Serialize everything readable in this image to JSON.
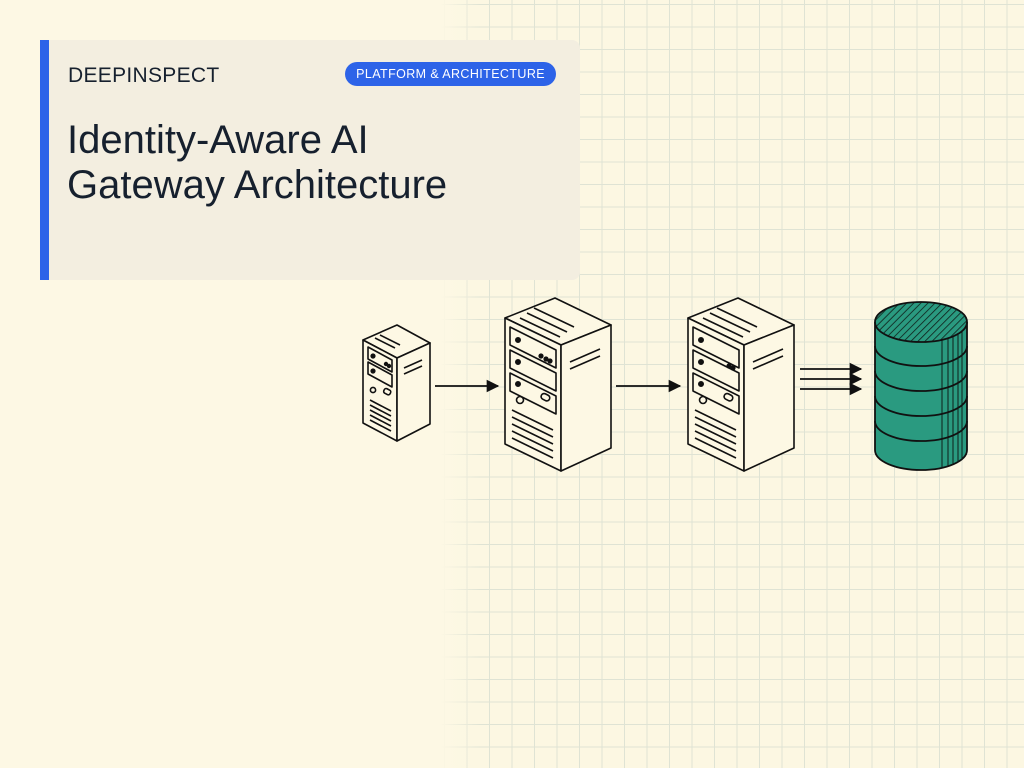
{
  "brand": {
    "name": "DEEPINSPECT"
  },
  "tag": {
    "label": "PLATFORM & ARCHITECTURE"
  },
  "title": {
    "line1": "Identity-Aware AI",
    "line2": "Gateway Architecture"
  },
  "colors": {
    "accent": "#2d63e8",
    "database": "#2a9a80",
    "background": "#fdf8e4",
    "card": "#f3eee0",
    "text": "#16202e"
  },
  "diagram": {
    "nodes": [
      {
        "icon": "server-tower-icon"
      },
      {
        "icon": "server-tower-icon"
      },
      {
        "icon": "server-tower-icon"
      },
      {
        "icon": "database-icon"
      }
    ],
    "edges": [
      {
        "from": 0,
        "to": 1,
        "type": "single-arrow"
      },
      {
        "from": 1,
        "to": 2,
        "type": "single-arrow"
      },
      {
        "from": 2,
        "to": 3,
        "type": "triple-arrow"
      }
    ]
  }
}
